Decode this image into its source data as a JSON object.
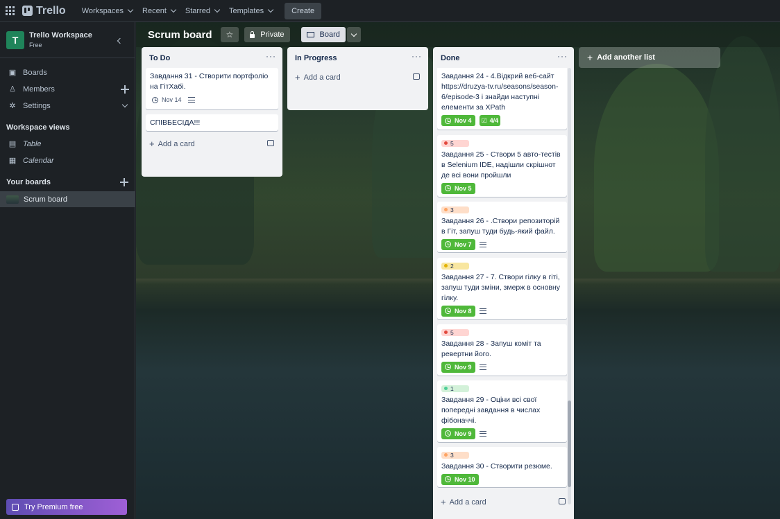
{
  "topbar": {
    "logo": "Trello",
    "nav": [
      "Workspaces",
      "Recent",
      "Starred",
      "Templates"
    ],
    "create_label": "Create"
  },
  "sidebar": {
    "workspace_initial": "T",
    "workspace_name": "Trello Workspace",
    "workspace_plan": "Free",
    "items": [
      {
        "label": "Boards",
        "icon": "board-icon"
      },
      {
        "label": "Members",
        "icon": "person-icon"
      },
      {
        "label": "Settings",
        "icon": "gear-icon"
      }
    ],
    "workspace_views_heading": "Workspace views",
    "views": [
      {
        "label": "Table",
        "icon": "table-icon"
      },
      {
        "label": "Calendar",
        "icon": "calendar-icon"
      }
    ],
    "your_boards_heading": "Your boards",
    "boards": [
      "Scrum board"
    ],
    "premium_label": "Try Premium free"
  },
  "board": {
    "title": "Scrum board",
    "visibility": "Private",
    "view": "Board",
    "add_list": "Add another list"
  },
  "lists": {
    "todo": {
      "title": "To Do",
      "add_card": "Add a card",
      "cards": [
        {
          "title": "Завдання 31 - Створити портфоліо на ГітХабі.",
          "due": "Nov 14"
        },
        {
          "title": "СПІВБЕСІДА!!!"
        }
      ]
    },
    "inprogress": {
      "title": "In Progress",
      "add_card": "Add a card"
    },
    "done": {
      "title": "Done",
      "add_card": "Add a card",
      "cards": [
        {
          "title": "Завдання 24 - 4.Відкрий веб-сайт https://druzya-tv.ru/seasons/season-6/episode-3 і знайди наступні елементи за XPath",
          "due": "Nov 4",
          "checklist": "4/4"
        },
        {
          "label": "5",
          "title": "Завдання 25 - Створи 5 авто-тестів в Selenium IDE, надішли скрішнот де всі вони пройшли",
          "due": "Nov 5"
        },
        {
          "label": "3",
          "title": "Завдання 26 - .Створи репозиторій в Гіт, запуш туди будь-який файл.",
          "due": "Nov 7"
        },
        {
          "label": "2",
          "title": "Завдання 27 - 7. Створи гілку в гіті, запуш туди зміни, змерж в основну гілку.",
          "due": "Nov 8"
        },
        {
          "label": "5",
          "title": "Завдання 28 - Запуш коміт та ревертни його.",
          "due": "Nov 9"
        },
        {
          "label": "1",
          "title": "Завдання 29 - Оціни всі свої попередні завдання в числах фібоначчі.",
          "due": "Nov 9"
        },
        {
          "label": "3",
          "title": "Завдання 30 - Створити резюме.",
          "due": "Nov 10"
        }
      ]
    }
  }
}
